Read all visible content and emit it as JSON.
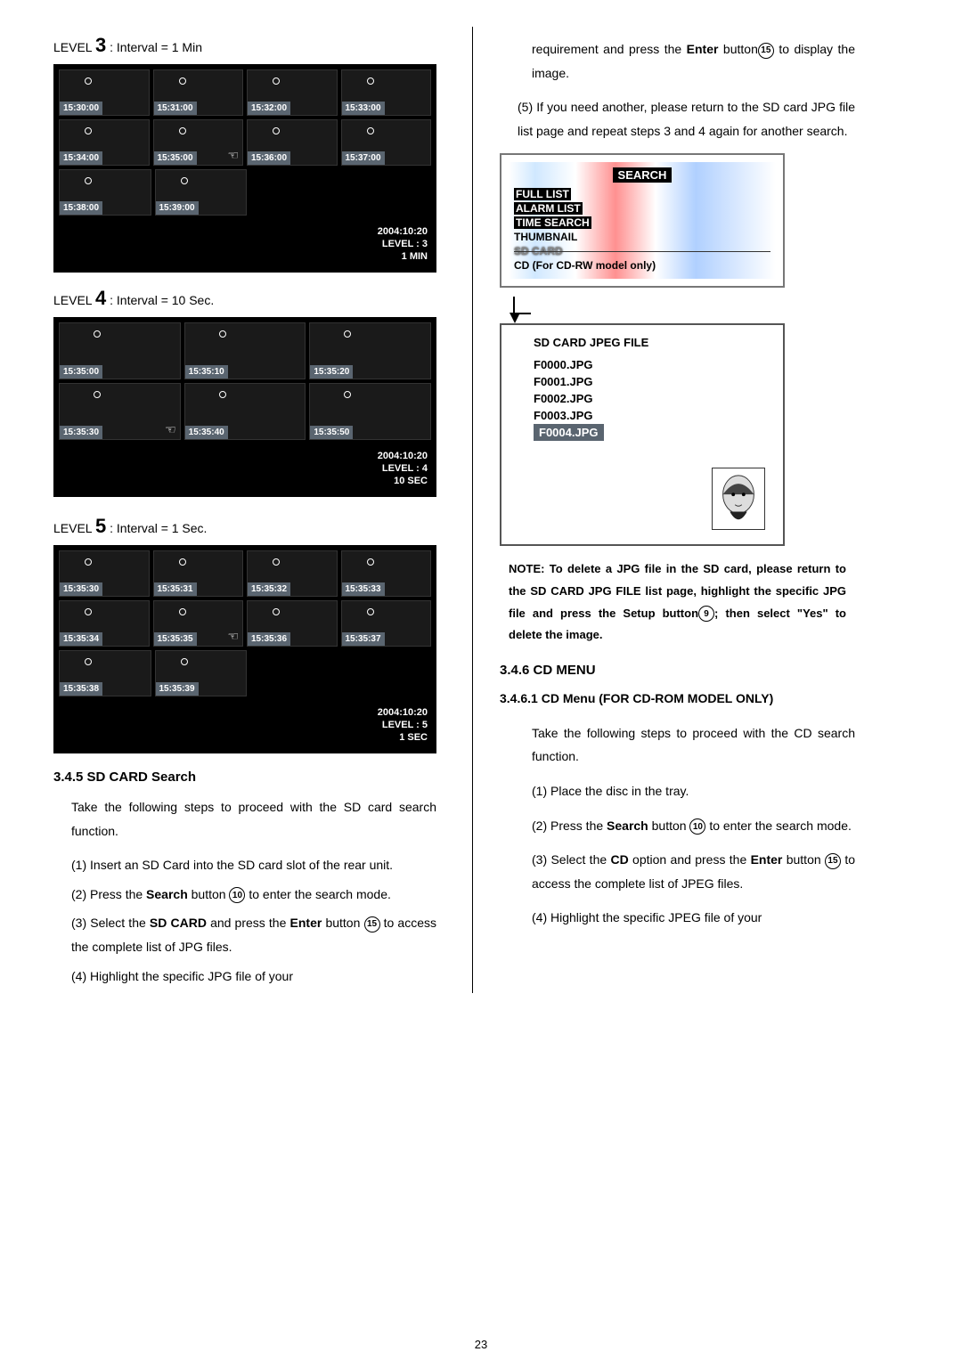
{
  "left": {
    "level3": {
      "title_pre": "LEVEL ",
      "title_num": "3",
      "title_post": " : Interval = 1 Min",
      "timestamps": [
        "15:30:00",
        "15:31:00",
        "15:32:00",
        "15:33:00",
        "15:34:00",
        "15:35:00",
        "15:36:00",
        "15:37:00",
        "15:38:00",
        "15:39:00"
      ],
      "info": [
        "2004:10:20",
        "LEVEL : 3",
        "1 MIN"
      ]
    },
    "level4": {
      "title_pre": "LEVEL ",
      "title_num": "4",
      "title_post": " : Interval = 10 Sec.",
      "timestamps": [
        "15:35:00",
        "15:35:10",
        "15:35:20",
        "15:35:30",
        "15:35:40",
        "15:35:50"
      ],
      "info": [
        "2004:10:20",
        "LEVEL : 4",
        "10 SEC"
      ]
    },
    "level5": {
      "title_pre": "LEVEL ",
      "title_num": "5",
      "title_post": " : Interval = 1 Sec.",
      "timestamps": [
        "15:35:30",
        "15:35:31",
        "15:35:32",
        "15:35:33",
        "15:35:34",
        "15:35:35",
        "15:35:36",
        "15:35:37",
        "15:35:38",
        "15:35:39"
      ],
      "info": [
        "2004:10:20",
        "LEVEL : 5",
        "1 SEC"
      ]
    },
    "sd_search": {
      "heading": "3.4.5 SD CARD Search",
      "intro": "Take the following steps to proceed with the SD card search function.",
      "steps": [
        {
          "n": "(1)",
          "text": "Insert an SD Card into the SD card slot of the rear unit."
        },
        {
          "n": "(2)",
          "pre": "Press the ",
          "bold": "Search",
          "mid": " button ",
          "circ": "10",
          "post": " to enter the search mode."
        },
        {
          "n": "(3)",
          "pre": "Select the ",
          "bold": "SD CARD",
          "mid": " and press the ",
          "bold2": "Enter",
          "mid2": " button ",
          "circ": "15",
          "post": " to access the complete list of JPG files."
        },
        {
          "n": "(4)",
          "text": "Highlight the specific JPG file of your"
        }
      ]
    }
  },
  "right": {
    "cont": {
      "pre": "requirement and press the ",
      "bold": "Enter",
      "mid": " button",
      "circ": "15",
      "post": " to display the image."
    },
    "step5": {
      "n": "(5)",
      "text": "If you need another, please return to the SD card JPG file list page and repeat steps 3 and 4 again for another search."
    },
    "menu": {
      "title": "SEARCH",
      "items": [
        "FULL LIST",
        "ALARM LIST",
        "TIME SEARCH",
        "THUMBNAIL",
        "SD CARD",
        "CD (For CD-RW model only)"
      ],
      "struck_index": 4
    },
    "sdbox": {
      "title": "SD CARD JPEG FILE",
      "files": [
        "F0000.JPG",
        "F0001.JPG",
        "F0002.JPG",
        "F0003.JPG",
        "F0004.JPG"
      ],
      "selected_index": 4
    },
    "note": {
      "pre": "NOTE: To delete a JPG file in the SD card, please return to the SD CARD JPG FILE list page, highlight the specific JPG file and press the Setup button",
      "circ": "9",
      "post": "; then select \"Yes\" to delete the image."
    },
    "cd_menu": {
      "heading": "3.4.6 CD MENU"
    },
    "cd_sub": {
      "heading": "3.4.6.1 CD Menu (FOR CD-ROM MODEL ONLY)"
    },
    "cd_steps": {
      "intro": "Take the following steps to proceed with the CD search function.",
      "s1": "(1) Place the disc in the tray.",
      "s2": {
        "pre": "(2) Press the ",
        "bold": "Search",
        "mid": " button ",
        "circ": "10",
        "post": " to enter the search mode."
      },
      "s3": {
        "pre": "(3) Select the ",
        "bold": "CD",
        "mid": " option and press the ",
        "bold2": "Enter",
        "mid2": " button ",
        "circ": "15",
        "post": " to access the complete list of JPEG files."
      },
      "s4": "(4) Highlight the specific JPEG file of your"
    }
  },
  "page": "23"
}
